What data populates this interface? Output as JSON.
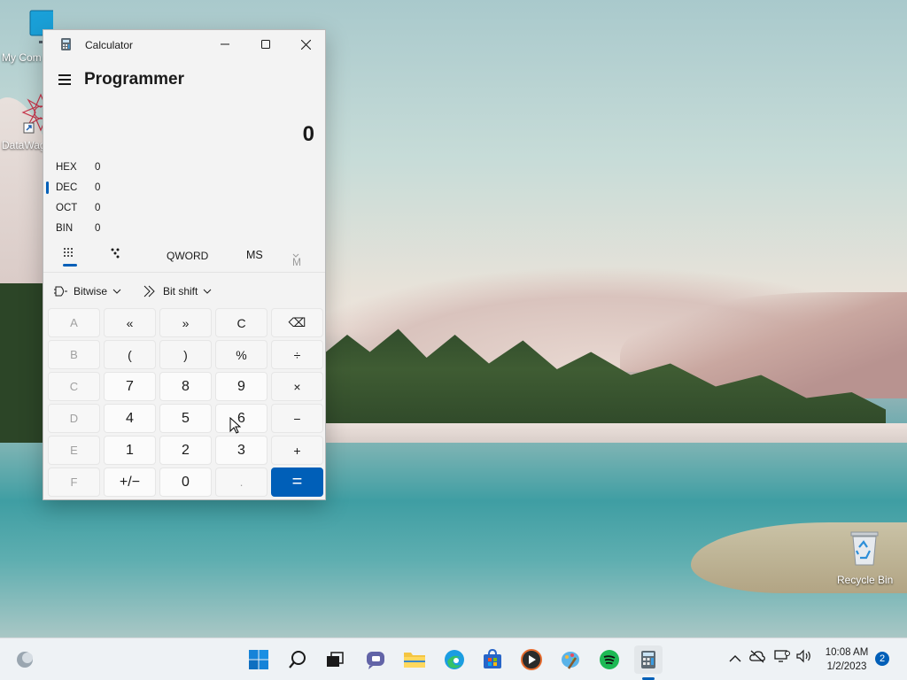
{
  "desktop": {
    "icons": [
      {
        "label": "My Com"
      },
      {
        "label": "DataWag"
      },
      {
        "label": "Recycle Bin"
      }
    ]
  },
  "calculator": {
    "window_title": "Calculator",
    "mode_title": "Programmer",
    "display_value": "0",
    "radix": [
      {
        "label": "HEX",
        "value": "0"
      },
      {
        "label": "DEC",
        "value": "0"
      },
      {
        "label": "OCT",
        "value": "0"
      },
      {
        "label": "BIN",
        "value": "0"
      }
    ],
    "selected_radix": "DEC",
    "word_size": "QWORD",
    "memory_store": "MS",
    "memory_recall": "M",
    "bitwise_label": "Bitwise",
    "bitshift_label": "Bit shift",
    "keys": [
      [
        "A",
        "«",
        "»",
        "C",
        "⌫"
      ],
      [
        "B",
        "(",
        ")",
        "%",
        "÷"
      ],
      [
        "C",
        "7",
        "8",
        "9",
        "×"
      ],
      [
        "D",
        "4",
        "5",
        "6",
        "−"
      ],
      [
        "E",
        "1",
        "2",
        "3",
        "+"
      ],
      [
        "F",
        "+/−",
        "0",
        ".",
        "="
      ]
    ]
  },
  "taskbar": {
    "clock_time": "10:08 AM",
    "clock_date": "1/2/2023",
    "notification_count": "2"
  }
}
